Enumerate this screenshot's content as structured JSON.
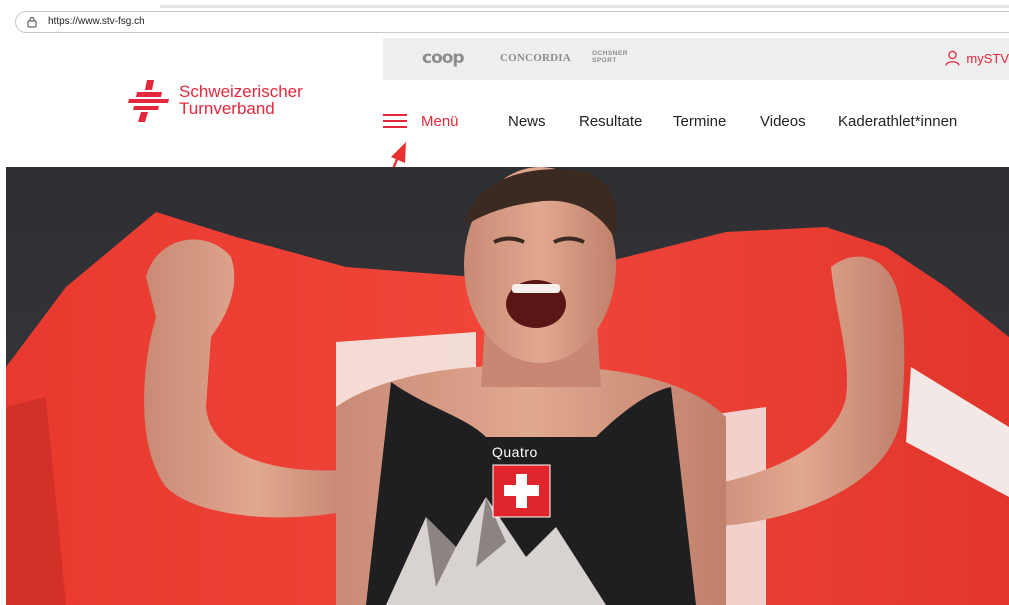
{
  "browser": {
    "url": "https://www.stv-fsg.ch"
  },
  "sponsors": {
    "coop": "coop",
    "concordia": "CONCORDIA",
    "ochsner_line1": "OCHSNER",
    "ochsner_line2": "SPORT"
  },
  "header": {
    "mystv_label": "mySTV",
    "logo_line1": "Schweizerischer",
    "logo_line2": "Turnverband"
  },
  "nav": {
    "menu_label": "Menü",
    "links": [
      "News",
      "Resultate",
      "Termine",
      "Videos",
      "Kaderathlet*innen"
    ]
  },
  "hero": {
    "jersey_text": "Quatro"
  },
  "colors": {
    "brand_red": "#e3283c",
    "sponsor_bg": "#eeeeee"
  }
}
